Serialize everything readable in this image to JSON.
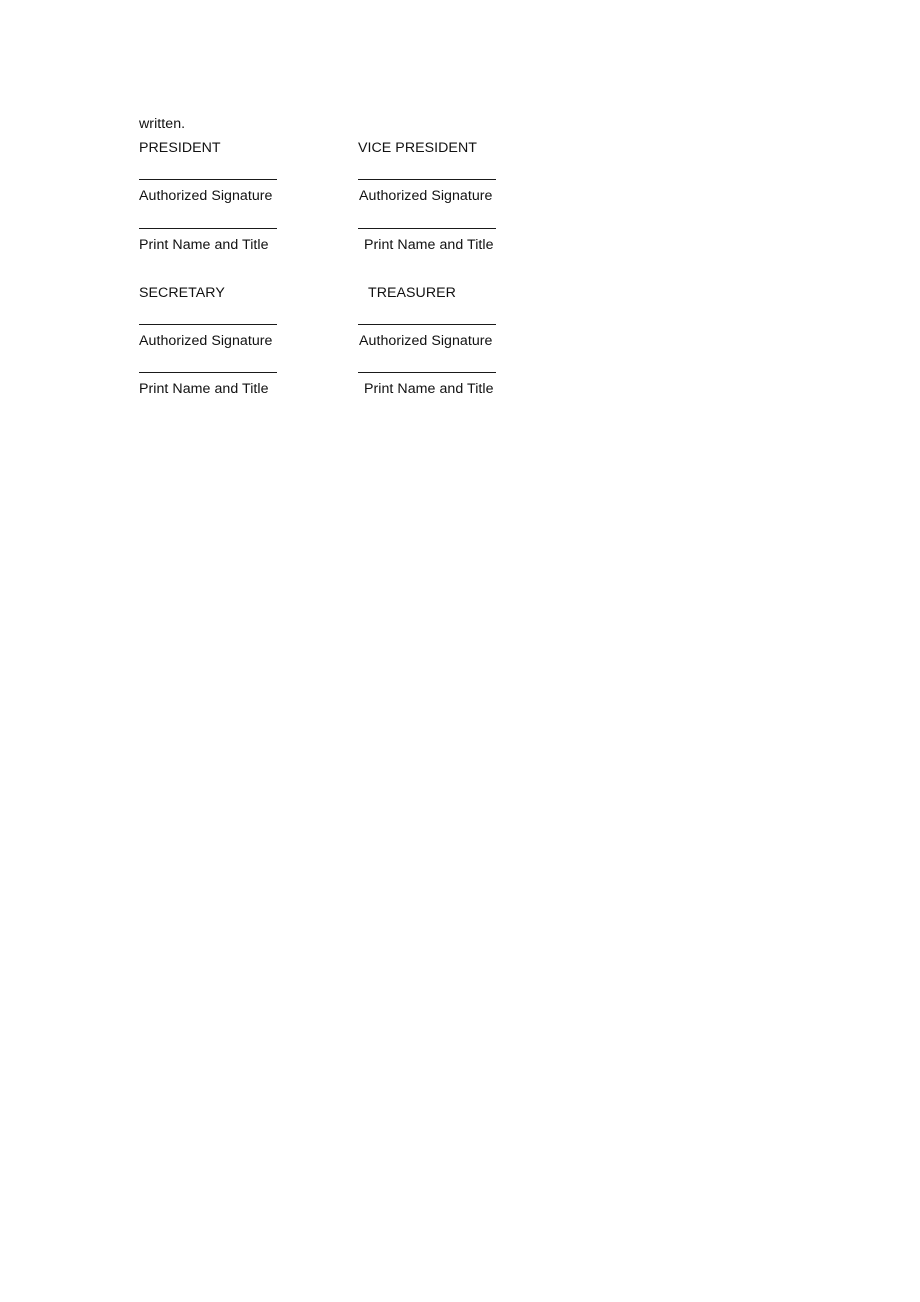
{
  "document": {
    "lead_text": "written.",
    "blocks": [
      {
        "left": {
          "role": "PRESIDENT",
          "signature_label": "Authorized Signature",
          "name_label": "Print Name and Title"
        },
        "right": {
          "role": "VICE PRESIDENT",
          "signature_label": "Authorized Signature",
          "name_label": "Print Name and Title"
        }
      },
      {
        "left": {
          "role": "SECRETARY",
          "signature_label": "Authorized Signature",
          "name_label": "Print Name and Title"
        },
        "right": {
          "role": "TREASURER",
          "signature_label": "Authorized Signature",
          "name_label": "Print Name and Title"
        }
      }
    ]
  }
}
